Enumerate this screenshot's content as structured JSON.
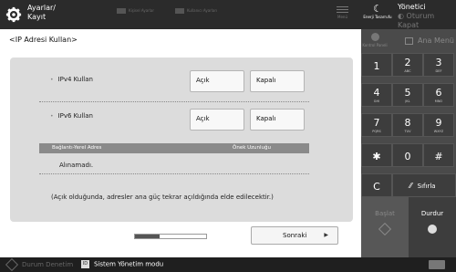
{
  "header": {
    "title_line1": "Ayarlar/",
    "title_line2": "Kayıt",
    "btn1": "Kişisel Ayarlar",
    "btn2": "Kullanıcı Ayarları",
    "menu": "Menü",
    "energy": "Enerji Tasarrufu",
    "admin": "Yönetici",
    "logout": "Oturum Kapat"
  },
  "main": {
    "page_title": "<IP Adresi Kullan>",
    "ipv4": {
      "label": "IPv4 Kullan",
      "on": "Açık",
      "off": "Kapalı"
    },
    "ipv6": {
      "label": "IPv6 Kullan",
      "on": "Açık",
      "off": "Kapalı"
    },
    "table": {
      "col1": "Bağlantı-Yerel Adres",
      "col2": "Önek Uzunluğu",
      "value": "Alınamadı."
    },
    "note": "(Açık olduğunda, adresler ana güç tekrar açıldığında elde edilecektir.)",
    "progress_fraction": 0.35,
    "next": "Sonraki"
  },
  "right": {
    "top_icon_label": "Kontrol Paneli",
    "home": "Ana Menü",
    "keys": [
      {
        "n": "1",
        "s": ""
      },
      {
        "n": "2",
        "s": "ABC"
      },
      {
        "n": "3",
        "s": "DEF"
      },
      {
        "n": "4",
        "s": "GHI"
      },
      {
        "n": "5",
        "s": "JKL"
      },
      {
        "n": "6",
        "s": "MNO"
      },
      {
        "n": "7",
        "s": "PQRS"
      },
      {
        "n": "8",
        "s": "TUV"
      },
      {
        "n": "9",
        "s": "WXYZ"
      },
      {
        "n": "✱",
        "s": ""
      },
      {
        "n": "0",
        "s": ""
      },
      {
        "n": "#",
        "s": ""
      }
    ],
    "c_key": "C",
    "clear": "Sıfırla",
    "start": "Başlat",
    "stop": "Durdur"
  },
  "status": {
    "error": "Durum Denetim",
    "sysmode_icon": "ID",
    "sysmode": "Sistem Yönetim modu"
  }
}
